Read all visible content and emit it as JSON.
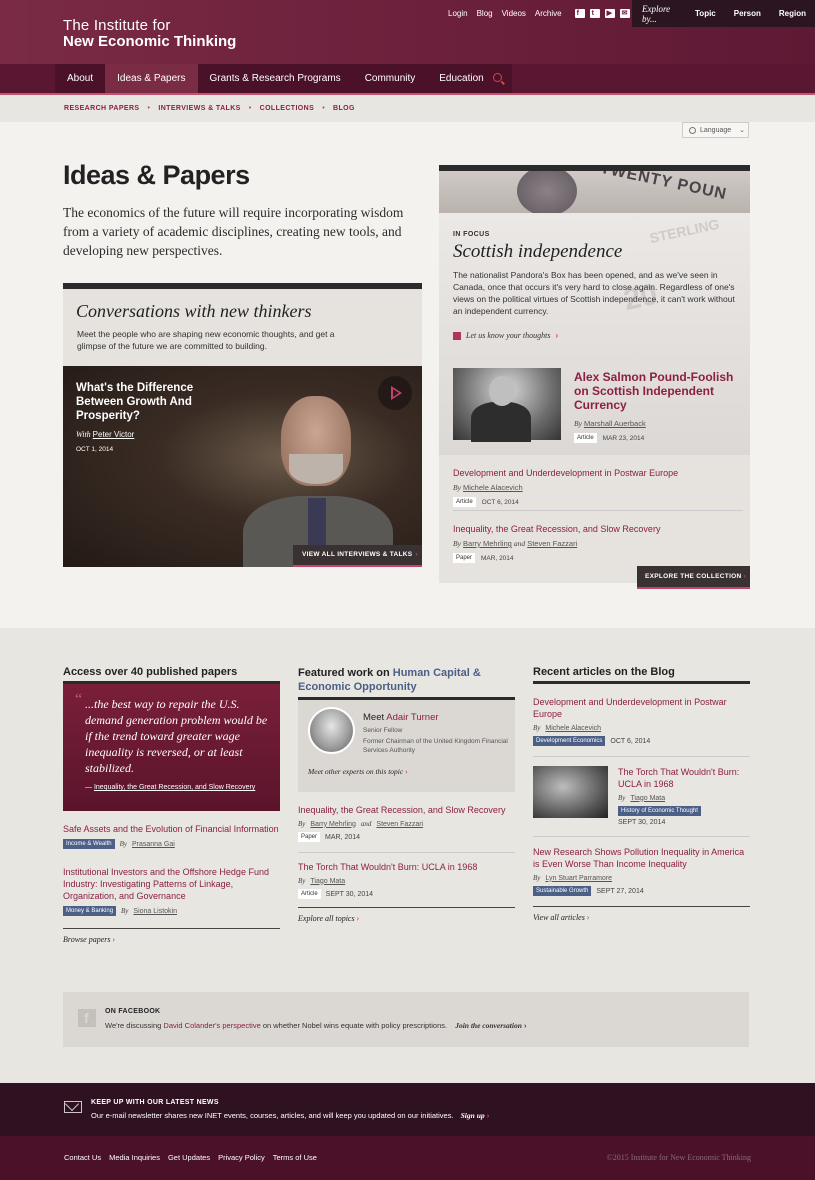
{
  "brand": {
    "line1": "The Institute for",
    "line2": "New Economic Thinking"
  },
  "util_nav": [
    "Login",
    "Blog",
    "Videos",
    "Archive"
  ],
  "social_icons": [
    "facebook-icon",
    "twitter-icon",
    "youtube-icon",
    "mail-icon"
  ],
  "explore": {
    "label": "Explore by...",
    "items": [
      "Topic",
      "Person",
      "Region"
    ]
  },
  "main_nav": {
    "items": [
      "About",
      "Ideas & Papers",
      "Grants & Research Programs",
      "Community",
      "Education"
    ],
    "active": "Ideas & Papers"
  },
  "sub_nav": [
    "RESEARCH PAPERS",
    "INTERVIEWS & TALKS",
    "COLLECTIONS",
    "BLOG"
  ],
  "language": "Language",
  "page": {
    "title": "Ideas & Papers",
    "lede": "The economics of the future will require incorporating wisdom from a variety of academic disciplines, creating new tools, and developing new perspectives."
  },
  "conversations": {
    "title": "Conversations with new thinkers",
    "desc": "Meet the people who are shaping new economic thoughts, and get a glimpse of the future we are committed to building.",
    "video_title": "What's the Difference Between Growth And Prosperity?",
    "with_label": "With",
    "with_person": "Peter Victor",
    "date": "OCT 1, 2014",
    "button": "VIEW ALL INTERVIEWS & TALKS"
  },
  "focus": {
    "category": "IN FOCUS",
    "title": "Scottish independence",
    "desc": "The nationalist Pandora's Box has been opened, and as we've seen in Canada, once that occurs it's very hard to close again. Regardless of one's views on the political virtues of Scottish independence, it can't work without an independent currency.",
    "cta": "Let us know your thoughts",
    "banner_text": "TWENTY POUN",
    "banner_sub": "STERLING",
    "featured": {
      "title": "Alex Salmon Pound-Foolish on Scottish Independent Currency",
      "by": "By",
      "author": "Marshall Auerback",
      "type": "Article",
      "date": "MAR 23, 2014"
    },
    "list": [
      {
        "title": "Development and Underdevelopment in Postwar Europe",
        "by": "By",
        "authors": "Michele Alacevich",
        "type": "Article",
        "date": "OCT 6, 2014"
      },
      {
        "title": "Inequality, the Great Recession, and Slow Recovery",
        "by": "By",
        "author1": "Barry Mehrling",
        "and": "and",
        "author2": "Steven Fazzari",
        "type": "Paper",
        "date": "MAR, 2014"
      }
    ],
    "button": "EXPLORE THE COLLECTION"
  },
  "papers": {
    "heading": "Access over 40 published papers",
    "quote": "...the best way to repair the U.S. demand generation problem would be if the trend toward greater wage inequality is reversed, or at least stabilized.",
    "quote_source": "Inequality, the Great Recession, and Slow Recovery",
    "items": [
      {
        "title": "Safe Assets and the Evolution of Financial Information",
        "tag": "Income & Wealth",
        "by": "By",
        "author": "Prasanna Gai"
      },
      {
        "title": "Institutional Investors and the Offshore Hedge Fund Industry: Investigating Patterns of Linkage, Organization, and Governance",
        "tag": "Money & Banking",
        "by": "By",
        "author": "Siona Listokin"
      }
    ],
    "more": "Browse papers"
  },
  "featured_work": {
    "heading_prefix": "Featured work on",
    "heading_topic": "Human Capital & Economic Opportunity",
    "meet_prefix": "Meet",
    "meet_name": "Adair Turner",
    "role1": "Senior Fellow",
    "role2": "Former Chairman of the United Kingdom Financial Services Authority",
    "other": "Meet other experts on this topic",
    "items": [
      {
        "title": "Inequality, the Great Recession, and Slow Recovery",
        "by": "By",
        "author1": "Barry Mehrling",
        "and": "and",
        "author2": "Steven Fazzari",
        "type": "Paper",
        "date": "MAR, 2014"
      },
      {
        "title": "The Torch That Wouldn't Burn: UCLA in 1968",
        "by": "By",
        "author": "Tiago Mata",
        "type": "Article",
        "date": "SEPT 30, 2014"
      }
    ],
    "more": "Explore all topics"
  },
  "blog": {
    "heading": "Recent articles on the Blog",
    "items": [
      {
        "title": "Development and Underdevelopment in Postwar Europe",
        "by": "By",
        "author": "Michele Alacevich",
        "tag": "Development Economics",
        "date": "OCT 6, 2014"
      },
      {
        "title": "The Torch That Wouldn't Burn: UCLA in 1968",
        "by": "By",
        "author": "Tiago Mata",
        "tag": "History of Economic Thought",
        "date": "SEPT 30, 2014"
      },
      {
        "title": "New Research Shows Pollution Inequality in America is Even Worse Than Income Inequality",
        "by": "By",
        "author": "Lyn Stuart Parramore",
        "tag": "Sustainable Growth",
        "date": "SEPT 27, 2014"
      }
    ],
    "more": "View all articles"
  },
  "facebook": {
    "heading": "ON FACEBOOK",
    "prefix": "We're discussing",
    "link": "David Colander's perspective",
    "suffix": "on whether Nobel wins equate with policy prescriptions.",
    "cta": "Join the conversation"
  },
  "newsletter": {
    "heading": "KEEP UP WITH OUR LATEST NEWS",
    "body": "Our e-mail newsletter shares new INET events, courses, articles, and will keep you updated on our initiatives.",
    "cta": "Sign up"
  },
  "footer": {
    "links": [
      "Contact Us",
      "Media Inquiries",
      "Get Updates",
      "Privacy Policy",
      "Terms of Use"
    ],
    "copyright": "©2015 Institute for New Economic Thinking"
  },
  "colors": {
    "brand": "#6a1f3a",
    "accent": "#c5426b",
    "link": "#8b2042",
    "tag_blue": "#4c5f87"
  }
}
